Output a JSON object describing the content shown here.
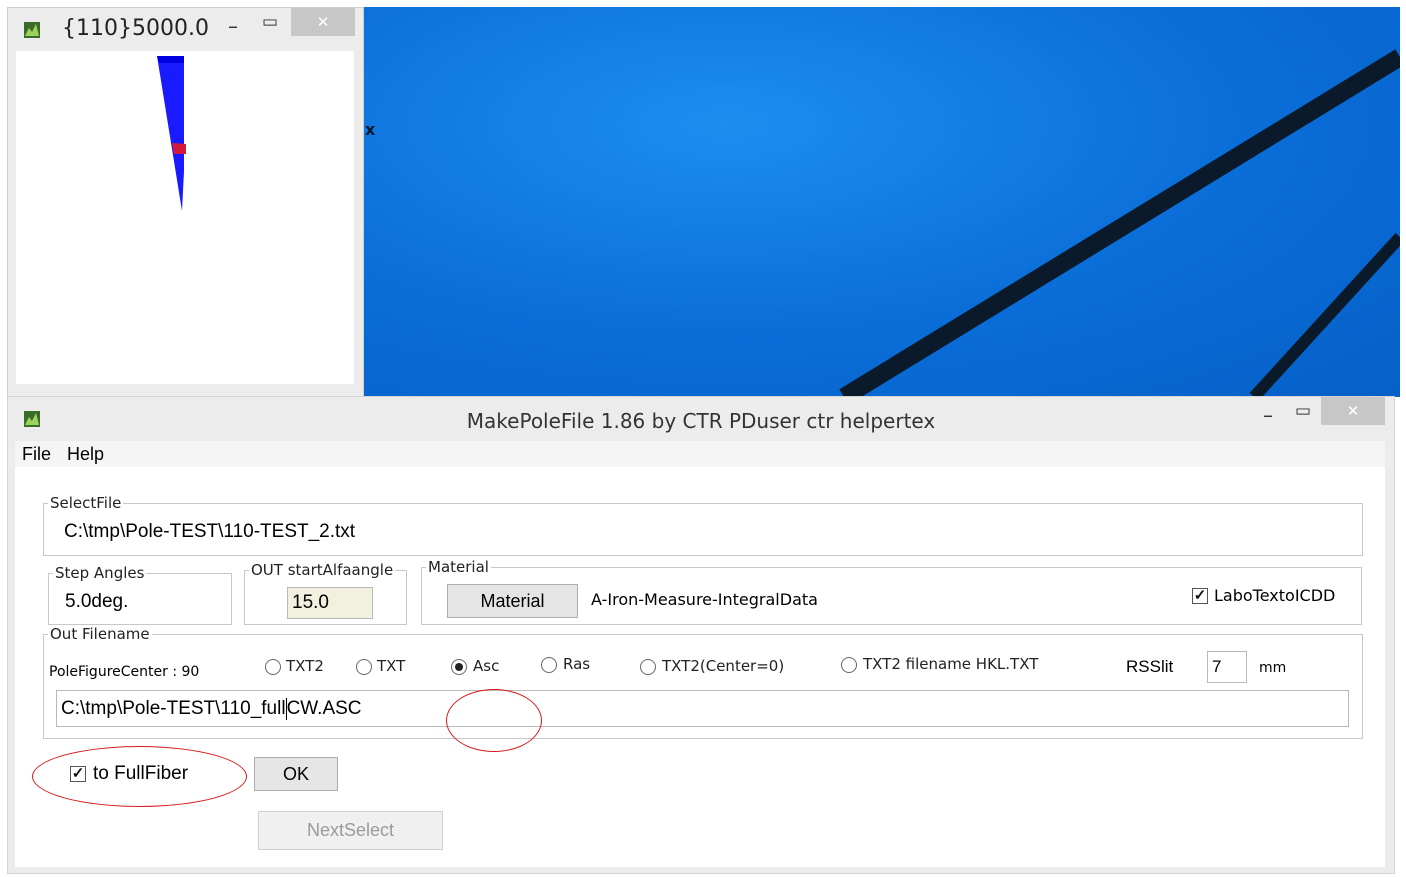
{
  "pole_window": {
    "title": "{110}5000.0",
    "minimize": "–",
    "maximize": "▭",
    "close": "✕"
  },
  "desktop": {
    "stray_mark": "x"
  },
  "dialog": {
    "title": "MakePoleFile 1.86 by CTR PDuser ctr helpertex",
    "minimize": "–",
    "maximize": "▭",
    "close": "✕",
    "menu": [
      "File",
      "Help"
    ],
    "select_file": {
      "legend": "SelectFile",
      "path": "C:\\tmp\\Pole-TEST\\110-TEST_2.txt"
    },
    "step_angles": {
      "legend": "Step Angles",
      "value": "5.0deg."
    },
    "out_start": {
      "legend": "OUT startAlfaangle",
      "value": "15.0"
    },
    "material": {
      "legend": "Material",
      "button": "Material",
      "name": "A-Iron-Measure-IntegralData",
      "labo_checkbox": "LaboTextoICDD",
      "labo_checked": true
    },
    "out_filename": {
      "legend": "Out Filename",
      "center_label": "PoleFigureCenter : 90",
      "radios": [
        {
          "label": "TXT2",
          "selected": false
        },
        {
          "label": "TXT",
          "selected": false
        },
        {
          "label": "Asc",
          "selected": true
        },
        {
          "label": "Ras",
          "selected": false
        },
        {
          "label": "TXT2(Center=0)",
          "selected": false
        },
        {
          "label": "TXT2 filename  HKL.TXT",
          "selected": false
        }
      ],
      "rsslit_label": "RSSlit",
      "rsslit_value": "7",
      "rsslit_unit": "mm",
      "path_before_cursor": "C:\\tmp\\Pole-TEST\\110_full",
      "path_after_cursor": "CW.ASC"
    },
    "full_fiber": {
      "label": "to FullFiber",
      "checked": true
    },
    "ok_button": "OK",
    "next_button": "NextSelect"
  }
}
